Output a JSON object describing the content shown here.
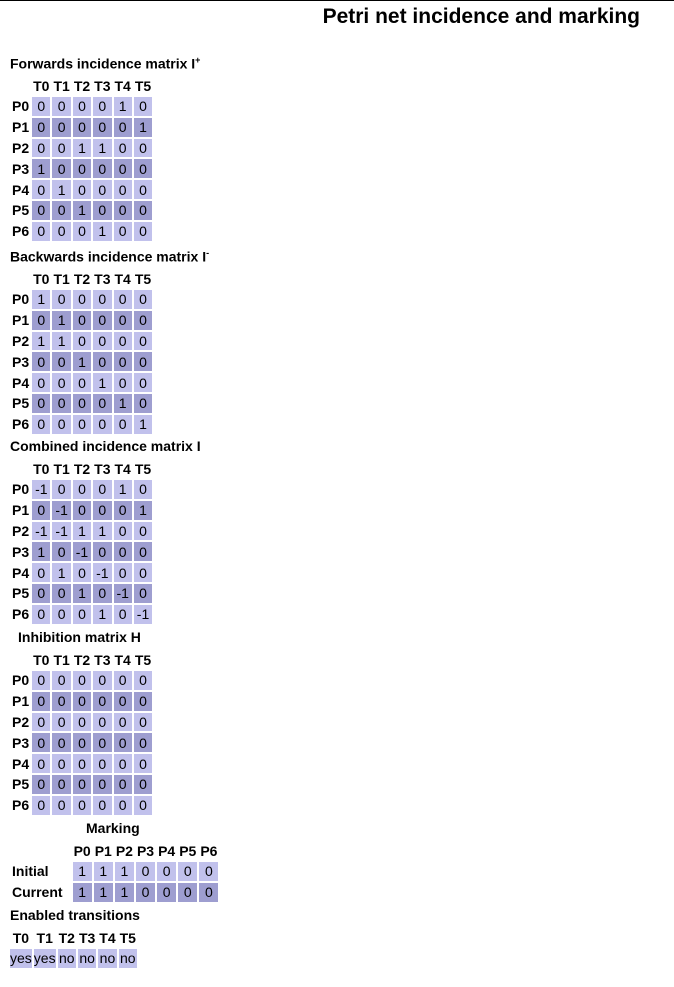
{
  "title": "Petri net incidence and marking",
  "transitions": [
    "T0",
    "T1",
    "T2",
    "T3",
    "T4",
    "T5"
  ],
  "places": [
    "P0",
    "P1",
    "P2",
    "P3",
    "P4",
    "P5",
    "P6"
  ],
  "forwards": {
    "caption": "Forwards incidence matrix I",
    "sup": "+",
    "rows": [
      [
        "0",
        "0",
        "0",
        "0",
        "1",
        "0"
      ],
      [
        "0",
        "0",
        "0",
        "0",
        "0",
        "1"
      ],
      [
        "0",
        "0",
        "1",
        "1",
        "0",
        "0"
      ],
      [
        "1",
        "0",
        "0",
        "0",
        "0",
        "0"
      ],
      [
        "0",
        "1",
        "0",
        "0",
        "0",
        "0"
      ],
      [
        "0",
        "0",
        "1",
        "0",
        "0",
        "0"
      ],
      [
        "0",
        "0",
        "0",
        "1",
        "0",
        "0"
      ]
    ]
  },
  "backwards": {
    "caption": "Backwards incidence matrix I",
    "sup": "-",
    "rows": [
      [
        "1",
        "0",
        "0",
        "0",
        "0",
        "0"
      ],
      [
        "0",
        "1",
        "0",
        "0",
        "0",
        "0"
      ],
      [
        "1",
        "1",
        "0",
        "0",
        "0",
        "0"
      ],
      [
        "0",
        "0",
        "1",
        "0",
        "0",
        "0"
      ],
      [
        "0",
        "0",
        "0",
        "1",
        "0",
        "0"
      ],
      [
        "0",
        "0",
        "0",
        "0",
        "1",
        "0"
      ],
      [
        "0",
        "0",
        "0",
        "0",
        "0",
        "1"
      ]
    ]
  },
  "combined": {
    "caption": "Combined incidence matrix I",
    "rows": [
      [
        "-1",
        "0",
        "0",
        "0",
        "1",
        "0"
      ],
      [
        "0",
        "-1",
        "0",
        "0",
        "0",
        "1"
      ],
      [
        "-1",
        "-1",
        "1",
        "1",
        "0",
        "0"
      ],
      [
        "1",
        "0",
        "-1",
        "0",
        "0",
        "0"
      ],
      [
        "0",
        "1",
        "0",
        "-1",
        "0",
        "0"
      ],
      [
        "0",
        "0",
        "1",
        "0",
        "-1",
        "0"
      ],
      [
        "0",
        "0",
        "0",
        "1",
        "0",
        "-1"
      ]
    ]
  },
  "inhibition": {
    "caption": "Inhibition matrix H",
    "rows": [
      [
        "0",
        "0",
        "0",
        "0",
        "0",
        "0"
      ],
      [
        "0",
        "0",
        "0",
        "0",
        "0",
        "0"
      ],
      [
        "0",
        "0",
        "0",
        "0",
        "0",
        "0"
      ],
      [
        "0",
        "0",
        "0",
        "0",
        "0",
        "0"
      ],
      [
        "0",
        "0",
        "0",
        "0",
        "0",
        "0"
      ],
      [
        "0",
        "0",
        "0",
        "0",
        "0",
        "0"
      ],
      [
        "0",
        "0",
        "0",
        "0",
        "0",
        "0"
      ]
    ]
  },
  "marking": {
    "caption": "Marking",
    "rows": [
      {
        "label": "Initial",
        "values": [
          "1",
          "1",
          "1",
          "0",
          "0",
          "0",
          "0"
        ]
      },
      {
        "label": "Current",
        "values": [
          "1",
          "1",
          "1",
          "0",
          "0",
          "0",
          "0"
        ]
      }
    ]
  },
  "enabled": {
    "caption": "Enabled transitions",
    "values": [
      "yes",
      "yes",
      "no",
      "no",
      "no",
      "no"
    ]
  },
  "colors": {
    "row_light": "#c1c1ec",
    "row_dark": "#9e9ed0"
  }
}
